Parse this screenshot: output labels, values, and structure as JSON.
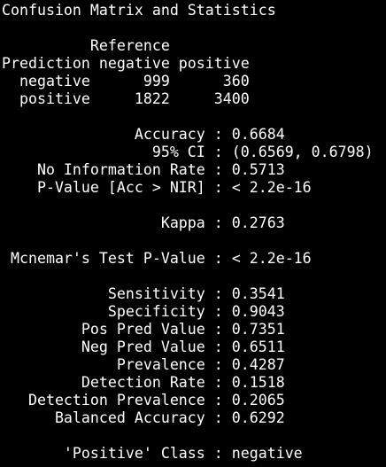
{
  "console": {
    "lines": [
      "Confusion Matrix and Statistics",
      "",
      "          Reference",
      "Prediction negative positive",
      "  negative      999      360",
      "  positive     1822     3400",
      "",
      "               Accuracy : 0.6684",
      "                 95% CI : (0.6569, 0.6798)",
      "    No Information Rate : 0.5713",
      "    P-Value [Acc > NIR] : < 2.2e-16",
      "",
      "                  Kappa : 0.2763",
      "",
      " Mcnemar's Test P-Value : < 2.2e-16",
      "",
      "            Sensitivity : 0.3541",
      "            Specificity : 0.9043",
      "         Pos Pred Value : 0.7351",
      "         Neg Pred Value : 0.6511",
      "             Prevalence : 0.4287",
      "         Detection Rate : 0.1518",
      "   Detection Prevalence : 0.2065",
      "      Balanced Accuracy : 0.6292",
      "",
      "       'Positive' Class : negative"
    ]
  }
}
